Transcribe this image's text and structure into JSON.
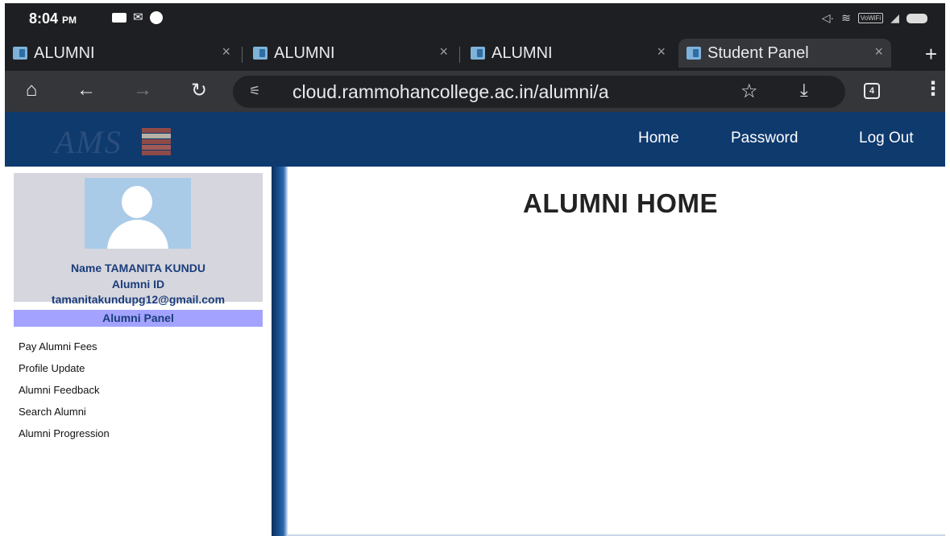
{
  "status_bar": {
    "time": "8:04",
    "ampm": "PM"
  },
  "browser": {
    "tabs": [
      {
        "title": "ALUMNI",
        "active": false
      },
      {
        "title": "ALUMNI",
        "active": false
      },
      {
        "title": "ALUMNI",
        "active": false
      },
      {
        "title": "Student Panel",
        "active": true
      }
    ],
    "close_glyph": "×",
    "new_tab_glyph": "+",
    "url": "cloud.rammohancollege.ac.in/alumni/a",
    "tab_count": "4"
  },
  "site": {
    "logo_text": "AMS",
    "nav": [
      "Home",
      "Password",
      "Log Out"
    ],
    "header_color": "#0e3a6e"
  },
  "profile": {
    "name_line": "Name TAMANITA KUNDU",
    "id_line": "Alumni ID",
    "email": "tamanitakundupg12@gmail.com"
  },
  "sidebar": {
    "panel_title": "Alumni  Panel",
    "menu": [
      "Pay Alumni Fees",
      "Profile Update",
      "Alumni Feedback",
      "Search Alumni",
      "Alumni Progression"
    ]
  },
  "main": {
    "title": "ALUMNI HOME"
  }
}
